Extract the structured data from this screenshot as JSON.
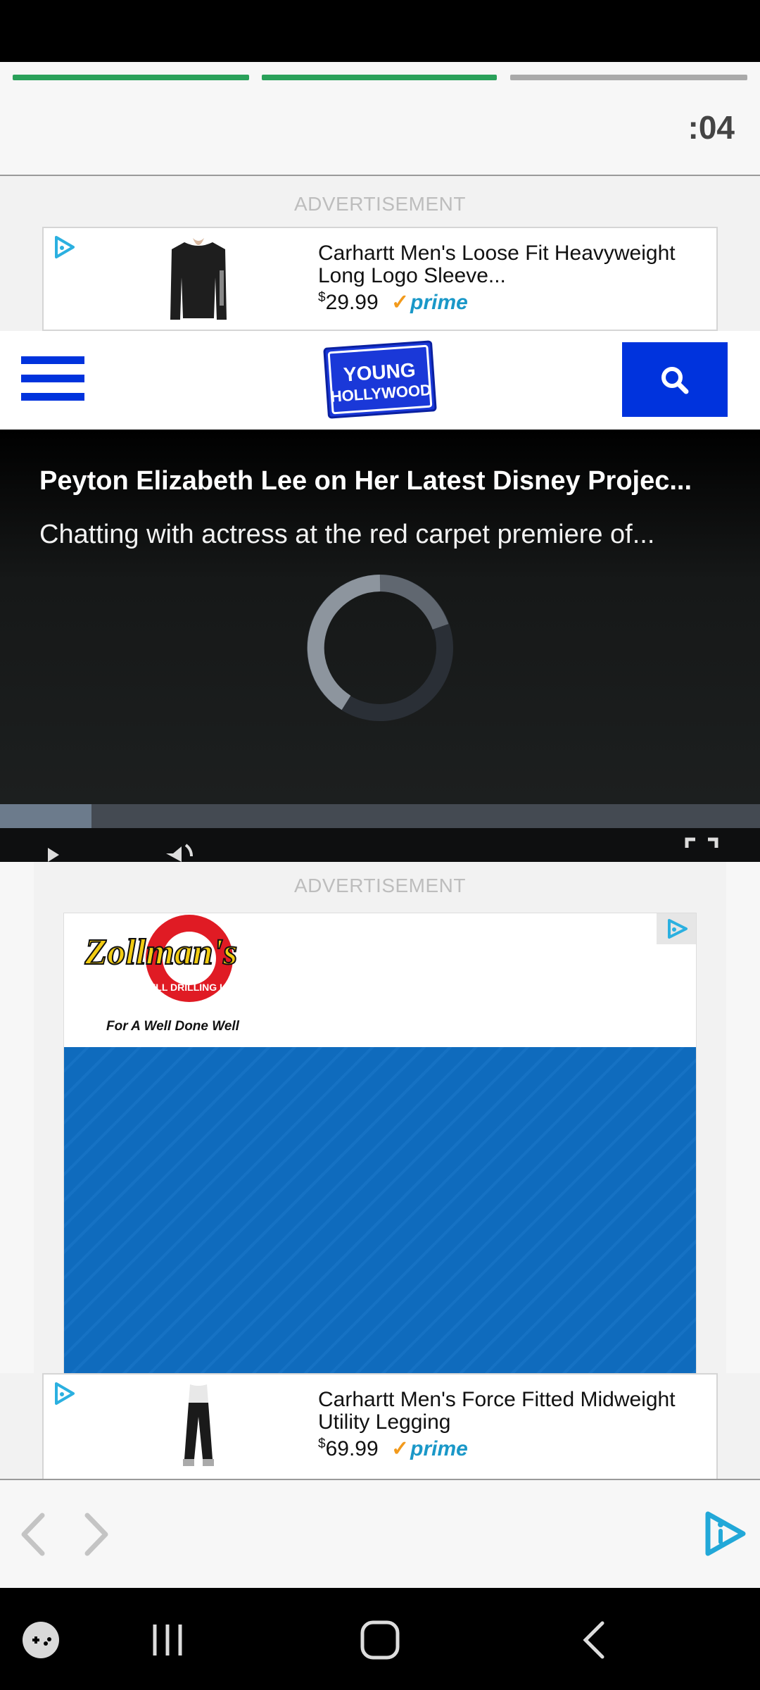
{
  "story": {
    "countdown": ":04",
    "segments_completed": 2,
    "segments_total": 3
  },
  "ad_top": {
    "label": "ADVERTISEMENT",
    "title": "Carhartt Men's Loose Fit Heavyweight Long Logo Sleeve...",
    "currency": "$",
    "price": "29.99",
    "badge": "prime"
  },
  "nav": {
    "logo_line1": "YOUNG",
    "logo_line2": "HOLLYWOOD"
  },
  "video": {
    "title": "Peyton Elizabeth Lee on Her Latest Disney Projec...",
    "subtitle": "Chatting with actress at the red carpet premiere of...",
    "progress_fraction": 0.12
  },
  "ad_bottom": {
    "label": "ADVERTISEMENT",
    "brand": "Zollman's",
    "brand_sub": "WELL DRILLING LLC",
    "tagline": "For A Well Done Well"
  },
  "ad_product2": {
    "title": "Carhartt Men's Force Fitted Midweight Utility Legging",
    "currency": "$",
    "price": "69.99",
    "badge": "prime"
  }
}
